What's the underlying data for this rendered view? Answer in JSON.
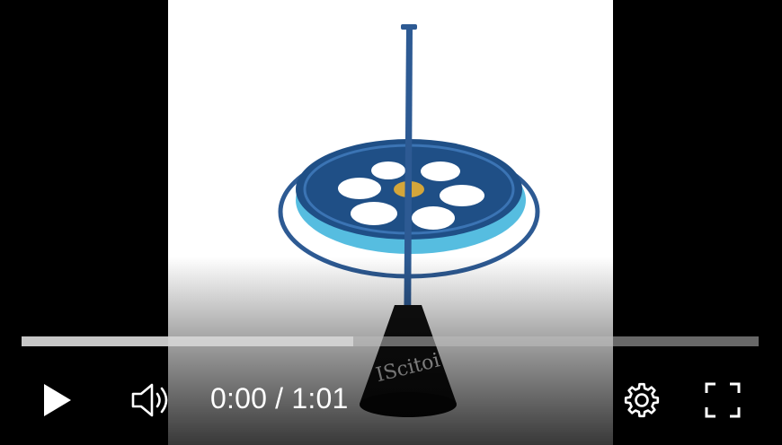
{
  "player": {
    "time": {
      "current": "0:00",
      "separator": " / ",
      "duration": "1:01"
    },
    "buffered_fraction": 0.45,
    "watermark": "IScitoi",
    "colors": {
      "ring": "#2d5a93",
      "disk_light": "#56bde0",
      "disk_dark": "#1f4f86",
      "hub": "#d4a63a",
      "base": "#111111",
      "control_icon": "#ffffff"
    },
    "controls": {
      "play": "play-icon",
      "volume": "volume-icon",
      "settings": "gear-icon",
      "fullscreen": "fullscreen-icon"
    }
  }
}
